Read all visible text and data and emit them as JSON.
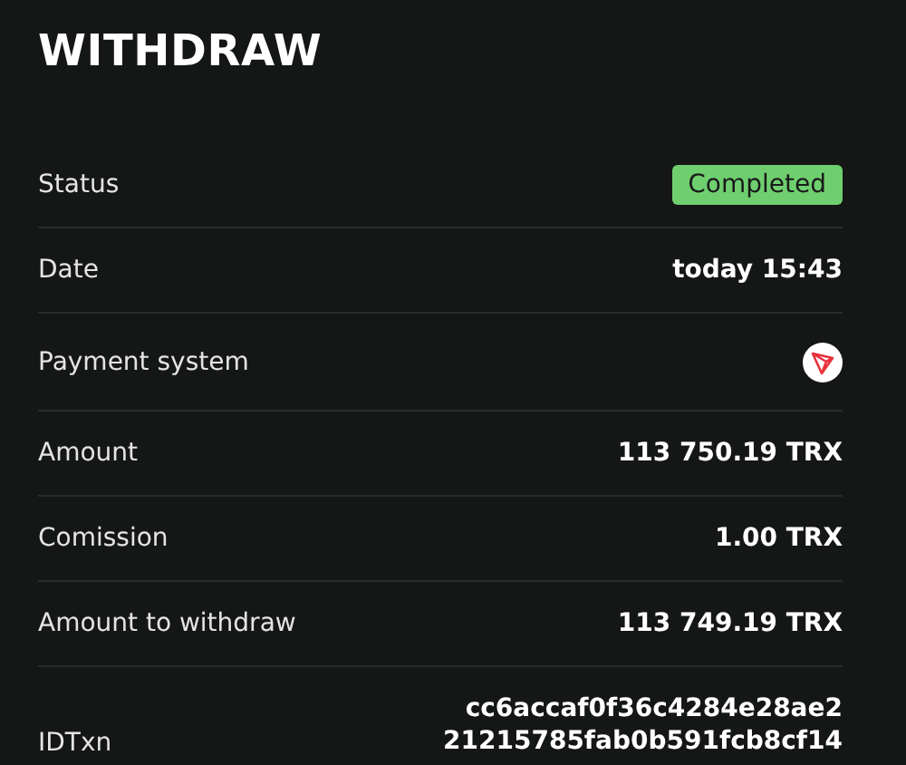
{
  "title": "WITHDRAW",
  "rows": [
    {
      "label": "Status",
      "kind": "badge",
      "value": "Completed"
    },
    {
      "label": "Date",
      "kind": "text",
      "value": "today 15:43"
    },
    {
      "label": "Payment system",
      "kind": "icon"
    },
    {
      "label": "Amount",
      "kind": "text",
      "value": "113 750.19 TRX"
    },
    {
      "label": "Comission",
      "kind": "text",
      "value": "1.00 TRX"
    },
    {
      "label": "Amount to withdraw",
      "kind": "text",
      "value": "113 749.19 TRX"
    },
    {
      "label": "IDTxn",
      "kind": "lines",
      "lines": [
        "cc6accaf0f36c4284e28ae2",
        "21215785fab0b591fcb8cf14"
      ]
    }
  ]
}
